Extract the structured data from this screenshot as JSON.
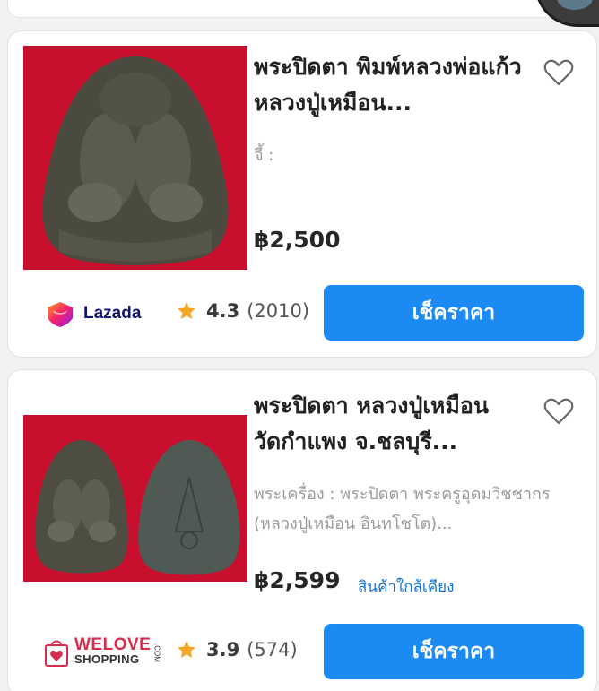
{
  "products": [
    {
      "title": "พระปิดตา พิมพ์หลวงพ่อแก้ว หลวงปู่เหมือน...",
      "subtitle": "จี้ :",
      "price": "฿2,500",
      "store": "Lazada",
      "rating": "4.3",
      "review_count": "(2010)",
      "button_label": "เช็คราคา"
    },
    {
      "title": "พระปิดตา หลวงปู่เหมือน วัดกำแพง จ.ชลบุรี...",
      "subtitle": "พระเครื่อง : พระปิดตา พระครูอุดมวิชชากร (หลวงปู่เหมือน อินทโชโต)...",
      "price": "฿2,599",
      "nearby_label": "สินค้าใกล้เคียง",
      "store_top": "WELOVE",
      "store_bottom": "SHOPPING",
      "store_com": ".COM",
      "rating": "3.9",
      "review_count": "(574)",
      "button_label": "เช็คราคา"
    }
  ],
  "colors": {
    "accent_button": "#1b8af2",
    "star": "#f5a623",
    "nearby_link": "#1573d6",
    "thumb_background": "#c8102e"
  },
  "icons": [
    "heart-icon",
    "star-icon",
    "lazada-logo",
    "welove-shopping-logo"
  ]
}
